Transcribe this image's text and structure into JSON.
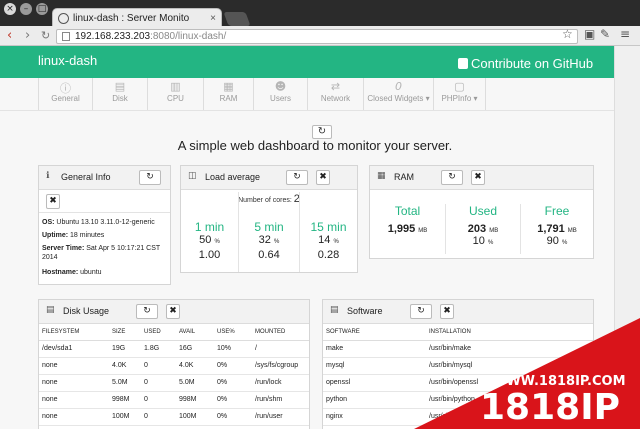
{
  "browser": {
    "tab_title": "linux-dash : Server Monito",
    "url_host": "192.168.233.203",
    "url_rest": ":8080/linux-dash/"
  },
  "header": {
    "brand": "linux-dash",
    "github": "Contribute on GitHub"
  },
  "nav": [
    {
      "label": "General",
      "icon": "info-icon"
    },
    {
      "label": "Disk",
      "icon": "disk-icon"
    },
    {
      "label": "CPU",
      "icon": "cpu-icon"
    },
    {
      "label": "RAM",
      "icon": "ram-icon"
    },
    {
      "label": "Users",
      "icon": "users-icon"
    },
    {
      "label": "Network",
      "icon": "network-icon"
    },
    {
      "label": "Closed Widgets",
      "count": "0"
    },
    {
      "label": "PHPInfo",
      "icon": "code-icon"
    }
  ],
  "tagline": "A simple web dashboard to monitor your server.",
  "general": {
    "title": "General Info",
    "os_label": "OS:",
    "os": "Ubuntu 13.10 3.11.0-12-generic",
    "uptime_label": "Uptime:",
    "uptime": "18 minutes",
    "time_label": "Server Time:",
    "time": "Sat Apr 5 10:17:21 CST 2014",
    "host_label": "Hostname:",
    "host": "ubuntu"
  },
  "load": {
    "title": "Load average",
    "cores_label": "Number of cores:",
    "cores": "2",
    "cols": [
      {
        "label": "1 min",
        "pct": "50",
        "val": "1.00"
      },
      {
        "label": "5 min",
        "pct": "32",
        "val": "0.64"
      },
      {
        "label": "15 min",
        "pct": "14",
        "val": "0.28"
      }
    ]
  },
  "ram": {
    "title": "RAM",
    "cols": [
      {
        "label": "Total",
        "val": "1,995",
        "unit": "MB",
        "pct": ""
      },
      {
        "label": "Used",
        "val": "203",
        "unit": "MB",
        "pct": "10"
      },
      {
        "label": "Free",
        "val": "1,791",
        "unit": "MB",
        "pct": "90"
      }
    ]
  },
  "disk": {
    "title": "Disk Usage",
    "headers": [
      "FILESYSTEM",
      "SIZE",
      "USED",
      "AVAIL",
      "USE%",
      "MOUNTED"
    ],
    "rows": [
      [
        "/dev/sda1",
        "19G",
        "1.8G",
        "16G",
        "10%",
        "/"
      ],
      [
        "none",
        "4.0K",
        "0",
        "4.0K",
        "0%",
        "/sys/fs/cgroup"
      ],
      [
        "none",
        "5.0M",
        "0",
        "5.0M",
        "0%",
        "/run/lock"
      ],
      [
        "none",
        "998M",
        "0",
        "998M",
        "0%",
        "/run/shm"
      ],
      [
        "none",
        "100M",
        "0",
        "100M",
        "0%",
        "/run/user"
      ]
    ]
  },
  "software": {
    "title": "Software",
    "headers": [
      "SOFTWARE",
      "INSTALLATION"
    ],
    "rows": [
      [
        "make",
        "/usr/bin/make"
      ],
      [
        "mysql",
        "/usr/bin/mysql"
      ],
      [
        "openssl",
        "/usr/bin/openssl"
      ],
      [
        "python",
        "/usr/bin/python"
      ],
      [
        "nginx",
        "/usr/sbin/nginx"
      ]
    ]
  },
  "watermark": {
    "url": "WWW.1818IP.COM",
    "big": "1818IP"
  },
  "colors": {
    "accent": "#23b583",
    "watermark": "#d9141a"
  }
}
